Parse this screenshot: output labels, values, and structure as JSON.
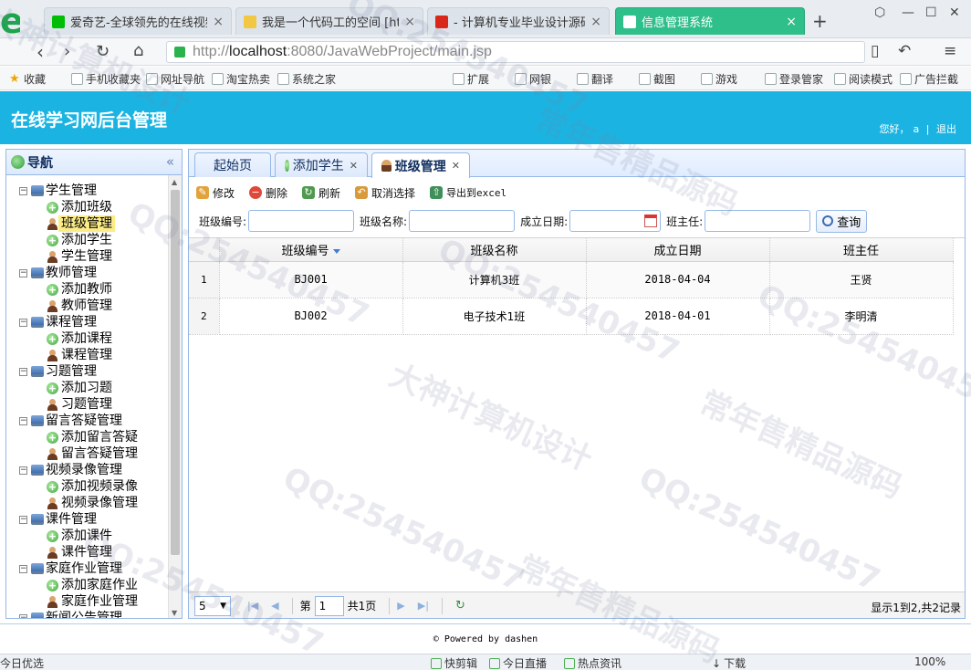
{
  "browser": {
    "tabs": [
      {
        "label": "爱奇艺-全球领先的在线视频",
        "fav_color": "#00be06"
      },
      {
        "label": "我是一个代码工的空间 [http",
        "fav_color": "#f2c744"
      },
      {
        "label": "- 计算机专业毕业设计源码网",
        "fav_color": "#d9281a"
      },
      {
        "label": "信息管理系统",
        "fav_color": "#ffffff"
      }
    ],
    "url_prefix": "http://",
    "url_host": "localhost",
    "url_rest": ":8080/JavaWebProject/main.jsp",
    "bookmarks": [
      {
        "label": "收藏",
        "icon": "star-icon"
      },
      {
        "label": "手机收藏夹",
        "icon": "phone-icon"
      },
      {
        "label": "网址导航",
        "icon": "page-icon"
      },
      {
        "label": "淘宝热卖",
        "icon": "page-icon"
      },
      {
        "label": "系统之家",
        "icon": "page-icon"
      },
      {
        "label": "扩展",
        "icon": "grid-icon"
      },
      {
        "label": "网银",
        "icon": "bank-icon"
      },
      {
        "label": "翻译",
        "icon": "translate-icon"
      },
      {
        "label": "截图",
        "icon": "scissors-icon"
      },
      {
        "label": "游戏",
        "icon": "gamepad-icon"
      },
      {
        "label": "登录管家",
        "icon": "key-icon"
      },
      {
        "label": "阅读模式",
        "icon": "book-icon"
      },
      {
        "label": "广告拦截",
        "icon": "block-icon"
      }
    ]
  },
  "app": {
    "title": "在线学习网后台管理",
    "greeting": "您好，",
    "user": "a",
    "logout": "退出"
  },
  "nav": {
    "title": "导航",
    "groups": [
      {
        "label": "学生管理",
        "items": [
          "添加班级",
          "班级管理",
          "添加学生",
          "学生管理"
        ]
      },
      {
        "label": "教师管理",
        "items": [
          "添加教师",
          "教师管理"
        ]
      },
      {
        "label": "课程管理",
        "items": [
          "添加课程",
          "课程管理"
        ]
      },
      {
        "label": "习题管理",
        "items": [
          "添加习题",
          "习题管理"
        ]
      },
      {
        "label": "留言答疑管理",
        "items": [
          "添加留言答疑",
          "留言答疑管理"
        ]
      },
      {
        "label": "视频录像管理",
        "items": [
          "添加视频录像",
          "视频录像管理"
        ]
      },
      {
        "label": "课件管理",
        "items": [
          "添加课件",
          "课件管理"
        ]
      },
      {
        "label": "家庭作业管理",
        "items": [
          "添加家庭作业",
          "家庭作业管理"
        ]
      },
      {
        "label": "新闻公告管理",
        "items": []
      }
    ],
    "selected": "班级管理"
  },
  "tabs": [
    {
      "label": "起始页",
      "closable": false
    },
    {
      "label": "添加学生",
      "closable": true
    },
    {
      "label": "班级管理",
      "closable": true
    }
  ],
  "toolbar": {
    "edit": "修改",
    "delete": "删除",
    "refresh": "刷新",
    "unselect": "取消选择",
    "export": "导出到excel"
  },
  "search": {
    "class_no_label": "班级编号:",
    "class_name_label": "班级名称:",
    "date_label": "成立日期:",
    "teacher_label": "班主任:",
    "button": "查询"
  },
  "grid": {
    "columns": [
      "班级编号",
      "班级名称",
      "成立日期",
      "班主任"
    ],
    "rows": [
      {
        "num": "1",
        "no": "BJ001",
        "name": "计算机3班",
        "date": "2018-04-04",
        "teacher": "王贤"
      },
      {
        "num": "2",
        "no": "BJ002",
        "name": "电子技术1班",
        "date": "2018-04-01",
        "teacher": "李明清"
      }
    ]
  },
  "pager": {
    "page_size": "5",
    "page_prefix": "第",
    "page_value": "1",
    "page_suffix": "共1页",
    "info": "显示1到2,共2记录"
  },
  "footer": "© Powered by dashen",
  "statusbar": {
    "left": "今日优选",
    "items": [
      "快剪辑",
      "今日直播",
      "热点资讯",
      "下载"
    ],
    "zoom": "100%"
  },
  "watermarks": [
    "大神计算机设计",
    "QQ:254540457",
    "常年售精品源码"
  ]
}
